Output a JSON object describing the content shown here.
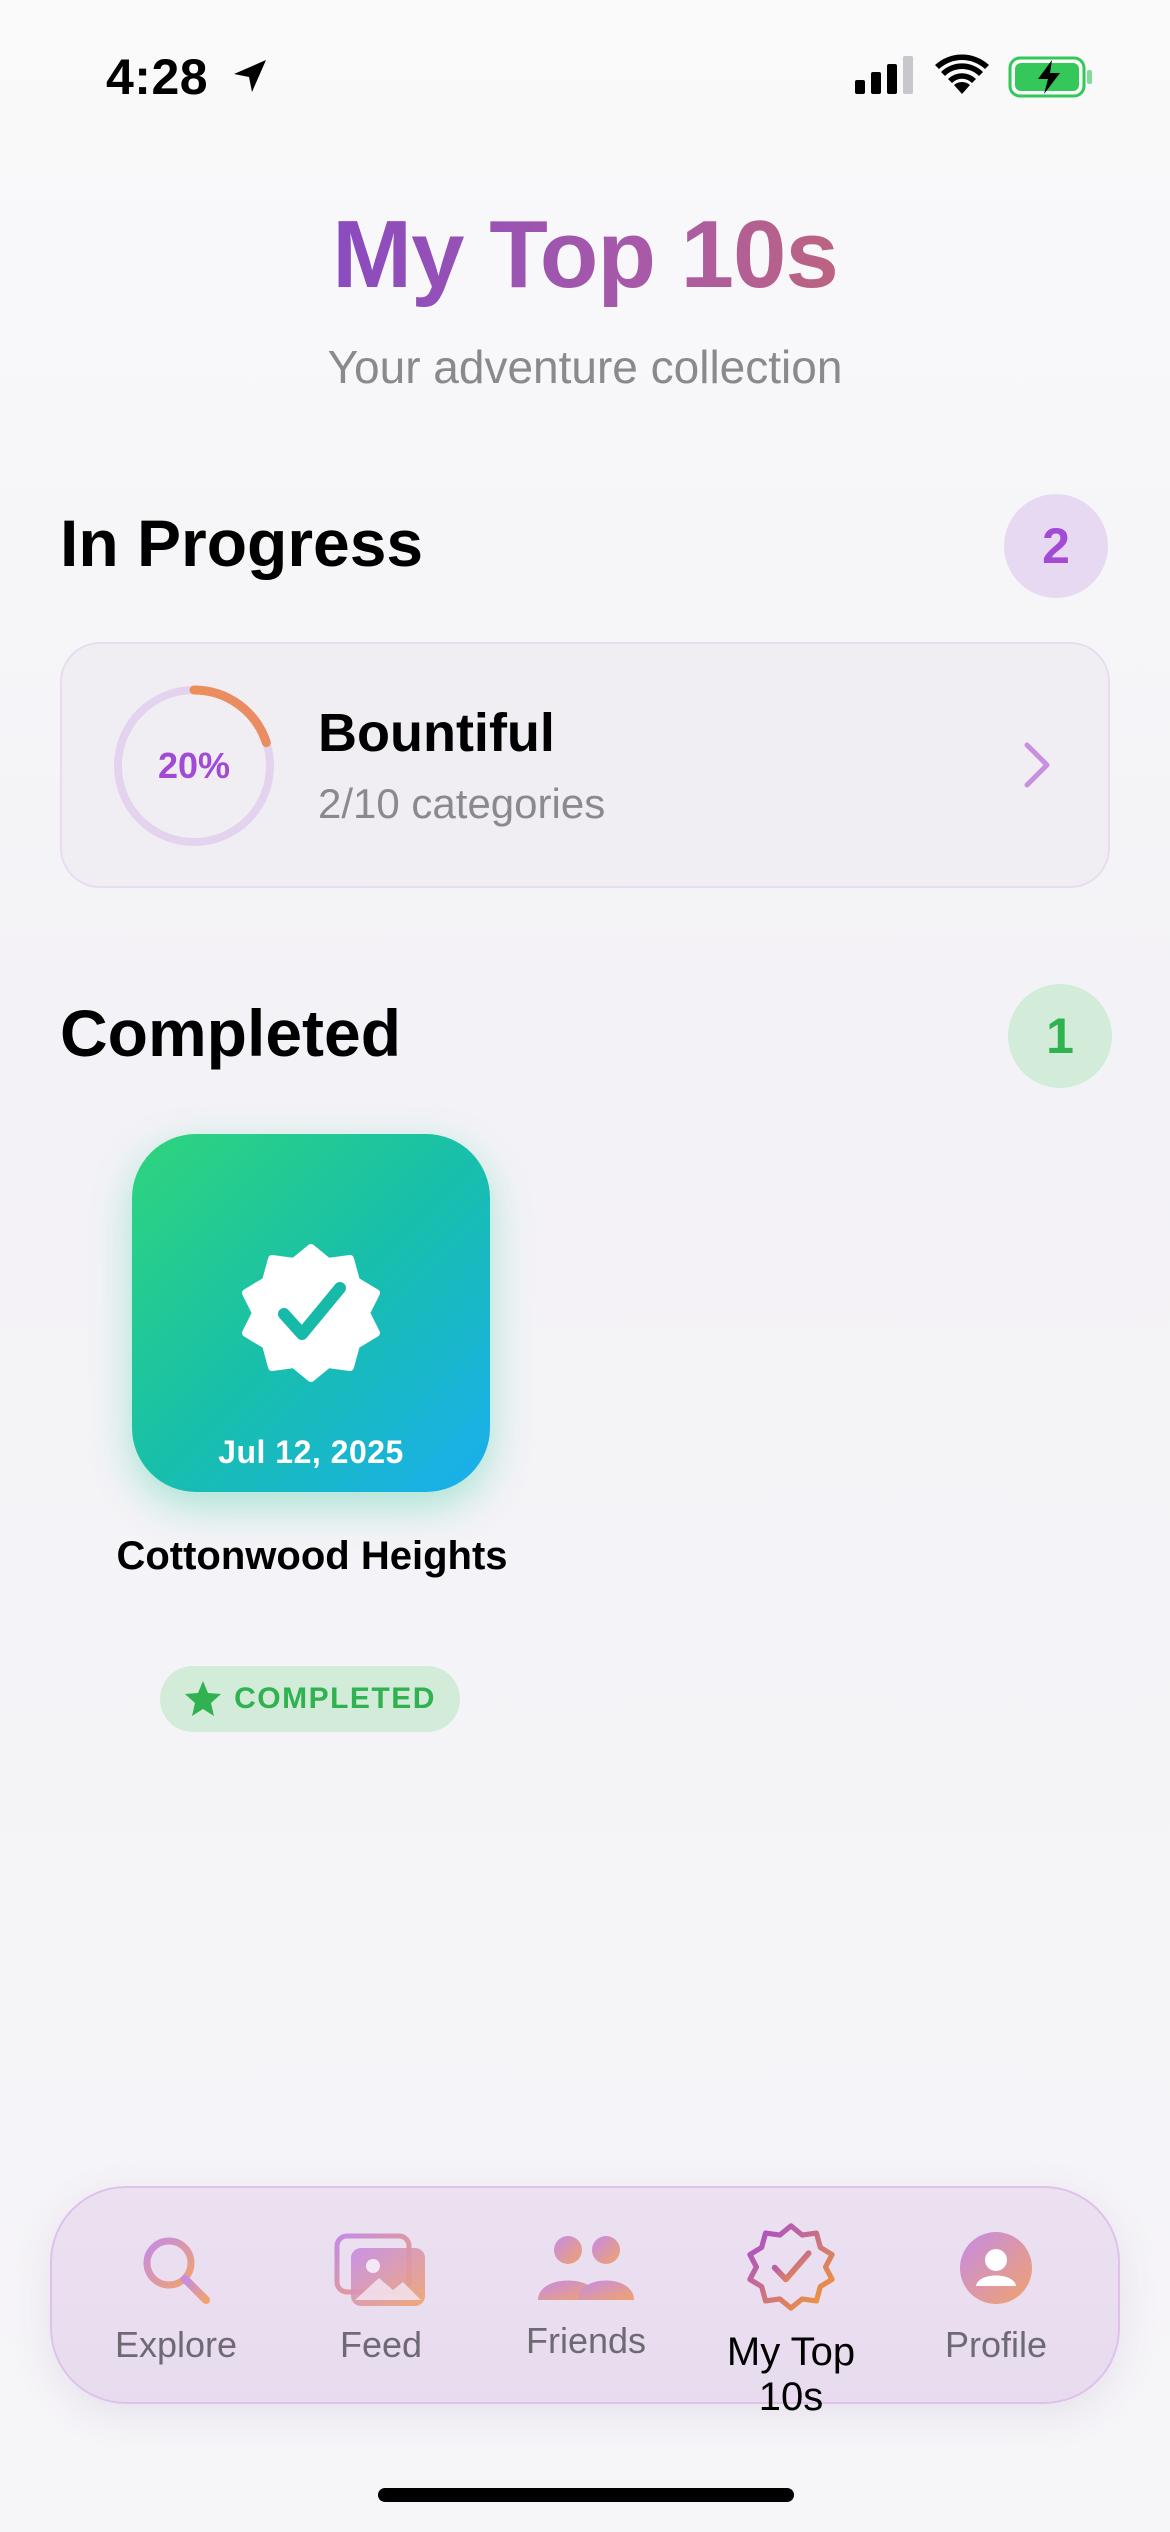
{
  "status_bar": {
    "time": "4:28",
    "battery_color": "#34c759"
  },
  "header": {
    "title": "My Top 10s",
    "subtitle": "Your adventure collection"
  },
  "in_progress": {
    "title": "In Progress",
    "count": "2",
    "items": [
      {
        "percent_label": "20%",
        "progress": 0.2,
        "name": "Bountiful",
        "detail": "2/10 categories"
      }
    ]
  },
  "completed": {
    "title": "Completed",
    "count": "1",
    "items": [
      {
        "date": "Jul 12, 2025",
        "name": "Cottonwood Heights",
        "status": "COMPLETED",
        "icon": "check-seal-icon"
      }
    ]
  },
  "tab_bar": {
    "tabs": [
      {
        "label": "Explore",
        "icon": "search-icon",
        "active": false
      },
      {
        "label": "Feed",
        "icon": "photos-icon",
        "active": false
      },
      {
        "label": "Friends",
        "icon": "people-icon",
        "active": false
      },
      {
        "label": "My Top 10s",
        "icon": "check-seal-icon",
        "active": true
      },
      {
        "label": "Profile",
        "icon": "profile-icon",
        "active": false
      }
    ]
  },
  "colors": {
    "accent_purple": "#a24ad6",
    "accent_orange": "#e0743d",
    "success_green": "#2fb24f"
  }
}
